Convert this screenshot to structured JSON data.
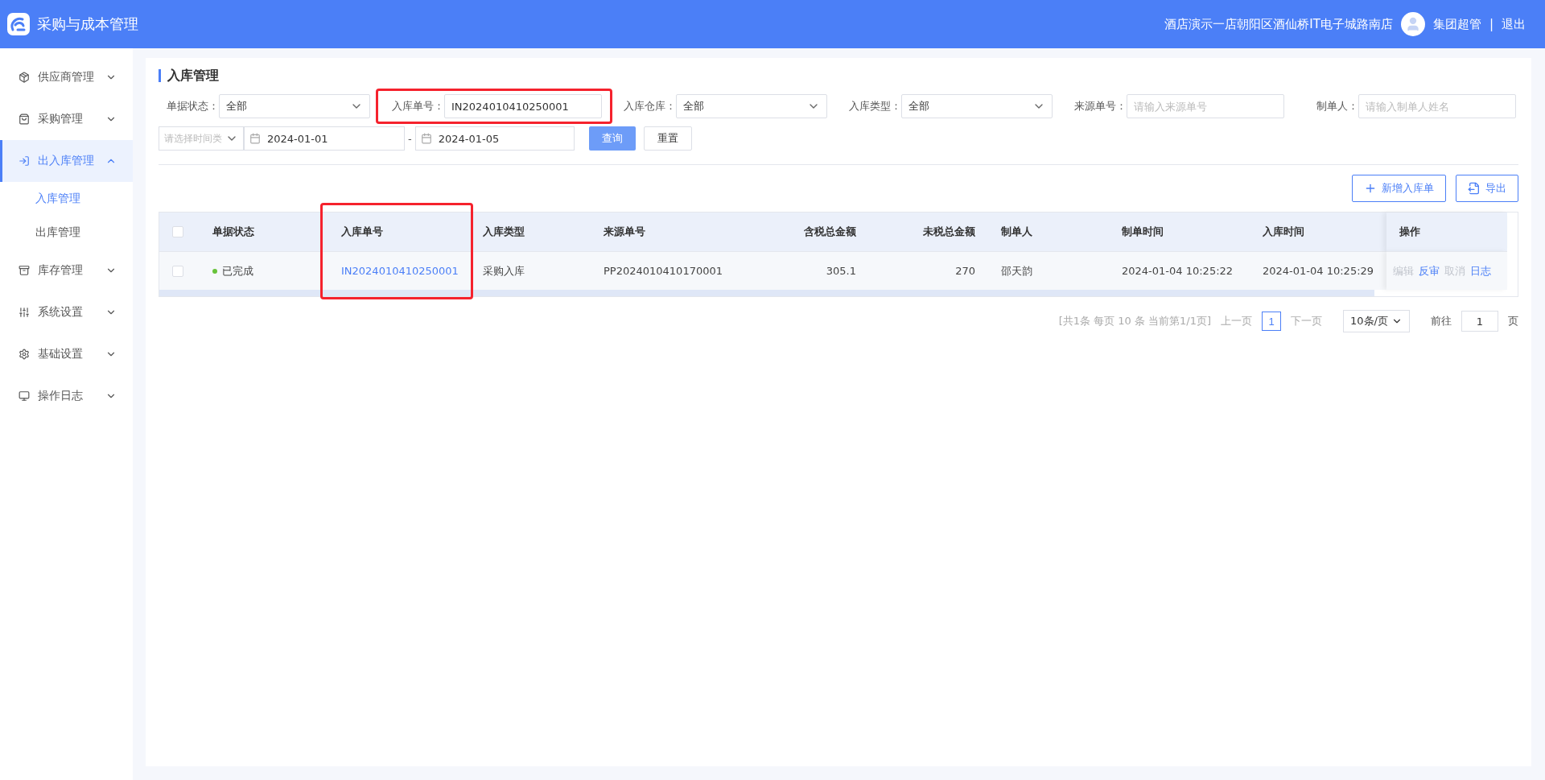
{
  "header": {
    "app_title": "采购与成本管理",
    "store": "酒店演示一店朝阳区酒仙桥IT电子城路南店",
    "user": "集团超管",
    "separator": "|",
    "logout": "退出"
  },
  "sidebar": {
    "items": [
      {
        "label": "供应商管理",
        "expanded": false,
        "selected": false
      },
      {
        "label": "采购管理",
        "expanded": false,
        "selected": false
      },
      {
        "label": "出入库管理",
        "expanded": true,
        "selected": true,
        "children": [
          {
            "label": "入库管理",
            "selected": true
          },
          {
            "label": "出库管理",
            "selected": false
          }
        ]
      },
      {
        "label": "库存管理",
        "expanded": false,
        "selected": false
      },
      {
        "label": "系统设置",
        "expanded": false,
        "selected": false
      },
      {
        "label": "基础设置",
        "expanded": false,
        "selected": false
      },
      {
        "label": "操作日志",
        "expanded": false,
        "selected": false
      }
    ]
  },
  "page_title": "入库管理",
  "filters": [
    {
      "kind": "select",
      "label": "单据状态：",
      "value": "全部",
      "highlighted": false
    },
    {
      "kind": "input",
      "label": "入库单号：",
      "value": "IN2024010410250001",
      "highlighted": true
    },
    {
      "kind": "select",
      "label": "入库仓库：",
      "value": "全部",
      "highlighted": false
    },
    {
      "kind": "select",
      "label": "入库类型：",
      "value": "全部",
      "highlighted": false
    },
    {
      "kind": "input",
      "label": "来源单号：",
      "placeholder": "请输入来源单号",
      "highlighted": false
    },
    {
      "kind": "input",
      "label": "制单人：",
      "placeholder": "请输入制单人姓名",
      "highlighted": false
    }
  ],
  "date_filter": {
    "type_placeholder": "请选择时间类",
    "start": "2024-01-01",
    "dash": "-",
    "end": "2024-01-05"
  },
  "buttons": {
    "query": "查询",
    "reset": "重置",
    "add": "新增入库单",
    "export": "导出"
  },
  "table": {
    "all_checked": false,
    "columns": [
      {
        "label": "单据状态",
        "kind": "status",
        "highlighted": false
      },
      {
        "label": "入库单号",
        "kind": "link",
        "highlighted": true
      },
      {
        "label": "入库类型",
        "kind": "text",
        "highlighted": false
      },
      {
        "label": "来源单号",
        "kind": "text",
        "highlighted": false
      },
      {
        "label": "含税总金额",
        "kind": "number",
        "highlighted": false
      },
      {
        "label": "未税总金额",
        "kind": "number",
        "highlighted": false
      },
      {
        "label": "制单人",
        "kind": "text",
        "highlighted": false
      },
      {
        "label": "制单时间",
        "kind": "text",
        "highlighted": false
      },
      {
        "label": "入库时间",
        "kind": "text",
        "highlighted": false
      }
    ],
    "action_column": "操作",
    "rows": [
      {
        "checked": false,
        "cells": [
          "已完成",
          "IN2024010410250001",
          "采购入库",
          "PP2024010410170001",
          "305.1",
          "270",
          "邵天韵",
          "2024-01-04 10:25:22",
          "2024-01-04 10:25:29"
        ],
        "actions": [
          {
            "label": "编辑",
            "disabled": true
          },
          {
            "label": "反审",
            "disabled": false
          },
          {
            "label": "取消",
            "disabled": true
          },
          {
            "label": "日志",
            "disabled": false
          }
        ]
      }
    ]
  },
  "pagination": {
    "summary": "[共1条 每页 10 条 当前第1/1页]",
    "prev": "上一页",
    "pages": [
      {
        "label": "1",
        "selected": true
      }
    ],
    "next": "下一页",
    "page_size": "10条/页",
    "goto_label": "前往",
    "goto_value": "1",
    "goto_suffix": "页"
  }
}
